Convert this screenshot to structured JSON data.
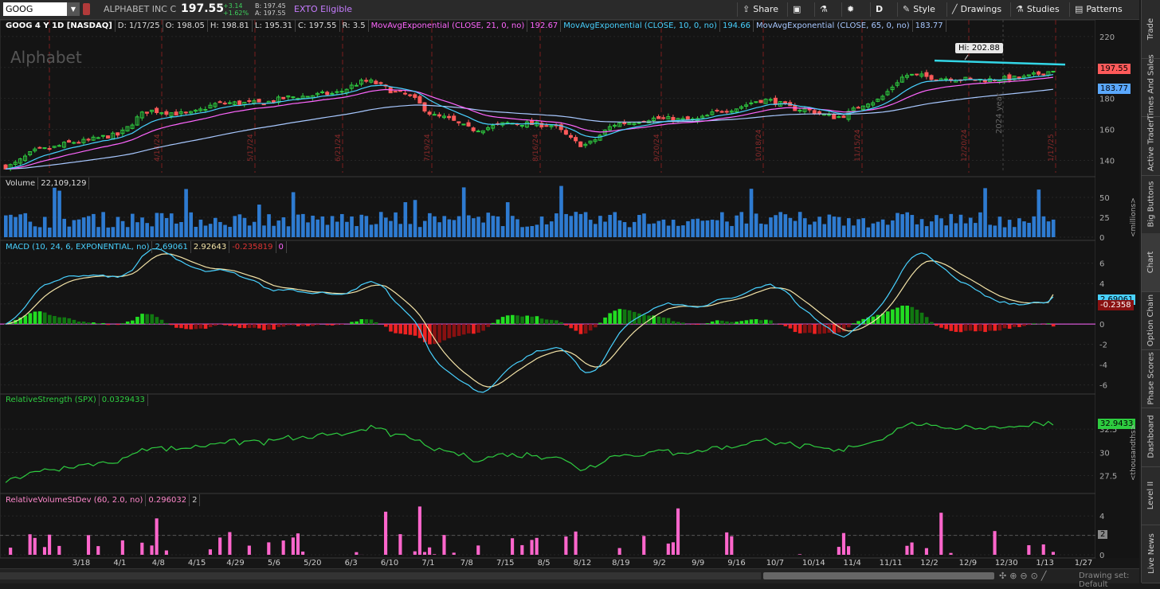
{
  "toolbar": {
    "symbol": "GOOG",
    "company": "ALPHABET INC C",
    "last": "197.55",
    "change_abs": "+3.14",
    "change_pct": "+1.62%",
    "bid": "B: 197.45",
    "ask": "A: 197.55",
    "exto": "EXTO Eligible",
    "share": "Share",
    "period": "D",
    "style": "Style",
    "drawings": "Drawings",
    "studies": "Studies",
    "patterns": "Patterns"
  },
  "price_header": {
    "title": "GOOG 4 Y 1D [NASDAQ]",
    "date": "D: 1/17/25",
    "open": "O: 198.05",
    "high": "H: 198.81",
    "low": "L: 195.31",
    "close": "C: 197.55",
    "range": "R: 3.5",
    "ma1_label": "MovAvgExponential (CLOSE, 21, 0, no)",
    "ma1_value": "192.67",
    "ma2_label": "MovAvgExponential (CLOSE, 10, 0, no)",
    "ma2_value": "194.66",
    "ma3_label": "MovAvgExponential (CLOSE, 65, 0, no)",
    "ma3_value": "183.77"
  },
  "watermark": "Alphabet",
  "hi_label": "Hi: 202.88",
  "price_badge": "197.55",
  "ma_badge": "183.77",
  "year_label": "2024 year",
  "volume_header": {
    "label": "Volume",
    "value": "22,109,129"
  },
  "volume_unit": "<millions>",
  "macd_header": {
    "label": "MACD (10, 24, 6, EXPONENTIAL, no)",
    "v1": "2.69061",
    "v2": "2.92643",
    "v3": "-0.235819",
    "v4": "0"
  },
  "macd_badge1": "2.69061",
  "macd_badge2": "-0.2358",
  "rs_header": {
    "label": "RelativeStrength (SPX)",
    "value": "0.0329433"
  },
  "rs_badge": "32.9433",
  "rs_unit": "<thousandths>",
  "rv_header": {
    "label": "RelativeVolumeStDev (60, 2.0, no)",
    "value": "0.296032",
    "v2": "2"
  },
  "rv_badge": "2",
  "drawing_set": "Drawing set: Default",
  "right_tabs": [
    "Trade",
    "Times And Sales",
    "Active Trader",
    "Big Buttons",
    "Chart",
    "Option Chain",
    "Phase Scores",
    "Dashboard",
    "Level II",
    "Live News"
  ],
  "colors": {
    "up": "#2ecc40",
    "down": "#ff5a5a",
    "ma21": "#ff66ff",
    "ma10": "#48d1ff",
    "ma65": "#a8c8ff",
    "volume": "#2e7bd1",
    "macd": "#48d1ff",
    "signal": "#f4e4a8",
    "rs": "#2ecc40",
    "rv": "#ff66cc",
    "hiline": "#33d6e6"
  },
  "chart_data": [
    {
      "type": "candlestick",
      "title": "GOOG 4 Y 1D [NASDAQ]",
      "y_ticks": [
        140,
        160,
        180,
        200,
        220
      ],
      "ylim": [
        132,
        223
      ],
      "x_date_labels": [
        "4/14/24",
        "5/17/24",
        "6/21/24",
        "7/19/24",
        "8/16/24",
        "9/20/24",
        "10/18/24",
        "11/15/24",
        "12/20/24",
        "1/17/25"
      ],
      "close_path": [
        {
          "x": "3/8",
          "y": 136
        },
        {
          "x": "3/22",
          "y": 147
        },
        {
          "x": "4/5",
          "y": 152
        },
        {
          "x": "4/19",
          "y": 156
        },
        {
          "x": "4/26",
          "y": 172
        },
        {
          "x": "5/10",
          "y": 170
        },
        {
          "x": "5/24",
          "y": 177
        },
        {
          "x": "6/7",
          "y": 177
        },
        {
          "x": "6/21",
          "y": 181
        },
        {
          "x": "6/28",
          "y": 183
        },
        {
          "x": "7/10",
          "y": 191
        },
        {
          "x": "7/17",
          "y": 183
        },
        {
          "x": "7/26",
          "y": 168
        },
        {
          "x": "8/5",
          "y": 160
        },
        {
          "x": "8/16",
          "y": 164
        },
        {
          "x": "8/30",
          "y": 163
        },
        {
          "x": "9/9",
          "y": 150
        },
        {
          "x": "9/20",
          "y": 164
        },
        {
          "x": "10/4",
          "y": 167
        },
        {
          "x": "10/18",
          "y": 166
        },
        {
          "x": "10/31",
          "y": 173
        },
        {
          "x": "11/8",
          "y": 179
        },
        {
          "x": "11/15",
          "y": 173
        },
        {
          "x": "11/22",
          "y": 168
        },
        {
          "x": "12/6",
          "y": 178
        },
        {
          "x": "12/11",
          "y": 195
        },
        {
          "x": "12/20",
          "y": 193
        },
        {
          "x": "12/31",
          "y": 192
        },
        {
          "x": "1/10",
          "y": 193
        },
        {
          "x": "1/17",
          "y": 197.55
        }
      ],
      "annotations": {
        "high": 202.88,
        "last": 197.55,
        "ma65_last": 183.77
      }
    },
    {
      "type": "bar",
      "title": "Volume",
      "y_ticks": [
        0,
        25,
        50
      ],
      "units": "millions",
      "last": 22.1
    },
    {
      "type": "line",
      "title": "MACD (10, 24, 6, EXPONENTIAL, no)",
      "y_ticks": [
        -6,
        -4,
        -2,
        0,
        2,
        4,
        6
      ],
      "macd_last": 2.69061,
      "signal_last": 2.92643,
      "hist_last": -0.235819
    },
    {
      "type": "line",
      "title": "RelativeStrength (SPX)",
      "y_ticks": [
        27.5,
        30,
        32.5
      ],
      "units": "thousandths",
      "last": 32.9433
    },
    {
      "type": "bar",
      "title": "RelativeVolumeStDev (60, 2.0, no)",
      "y_ticks": [
        0,
        2,
        4
      ],
      "last": 0.296032
    }
  ],
  "x_axis": [
    "3/18",
    "4/1",
    "4/8",
    "4/15",
    "4/29",
    "5/6",
    "5/20",
    "6/3",
    "6/10",
    "7/1",
    "7/8",
    "7/15",
    "8/5",
    "8/12",
    "8/19",
    "9/2",
    "9/9",
    "9/16",
    "10/7",
    "10/14",
    "11/4",
    "11/11",
    "12/2",
    "12/9",
    "12/30",
    "1/13",
    "1/27"
  ]
}
